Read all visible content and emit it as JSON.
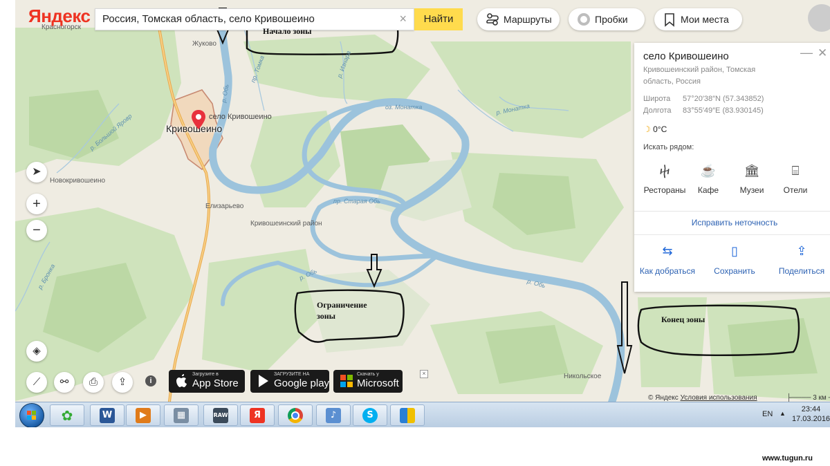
{
  "header": {
    "logo": "Яндекс",
    "search_value": "Россия, Томская область, село Кривошеино",
    "search_button": "Найти",
    "routes_label": "Маршруты",
    "traffic_label": "Пробки",
    "places_label": "Мои места"
  },
  "map_labels": {
    "zhukovo": "Жуково",
    "marker_label": "село Кривошеино",
    "town": "Кривошеино",
    "novokrivoshein": "Новокривошеино",
    "elizarevo": "Елизарьево",
    "district": "Кривошеинский район",
    "nikolskoe": "Никольское",
    "krasnyi": "Красный Яр",
    "river_ob1": "р. Обь",
    "river_ob2": "р. Обь",
    "river_ob3": "р. Обь",
    "staraya_ob": "пр. Старая Обь",
    "monatka_lake": "оз. Монатка",
    "monatka_river": "р. Монатка",
    "bolshoy_yarov": "р. Большой Яровр",
    "tomka": "пр. Томка",
    "izvara": "р. Изнара",
    "bronka": "р. Бронка",
    "krasnogorsk": "Красногорск"
  },
  "panel": {
    "title": "село Кривошеино",
    "subtitle": "Кривошеинский район, Томская область, Россия",
    "lat_label": "Широта",
    "lat_value": "57°20′38″N (57.343852)",
    "lon_label": "Долгота",
    "lon_value": "83°55′49″E (83.930145)",
    "weather": "0°C",
    "nearby_label": "Искать рядом:",
    "nearby": [
      "Рестораны",
      "Кафе",
      "Музеи",
      "Отели"
    ],
    "fix_link": "Исправить неточность",
    "actions": [
      "Как добраться",
      "Сохранить",
      "Поделиться"
    ]
  },
  "badges": {
    "appstore_small": "Загрузите в",
    "appstore_large": "App Store",
    "google_small": "ЗАГРУЗИТЕ НА",
    "google_large": "Google play",
    "ms_small": "Скачать у",
    "ms_large": "Microsoft"
  },
  "footer": {
    "copyright": "© Яндекс",
    "terms": "Условия использования",
    "scale": "3 км"
  },
  "taskbar": {
    "lang": "EN",
    "time": "23:44",
    "date": "17.03.2016",
    "raw_label": "RAW"
  },
  "annotations": {
    "start": "Начало зоны",
    "limit": "Ограничение зоны",
    "end": "Конец зоны"
  },
  "watermark": "www.tugun.ru"
}
